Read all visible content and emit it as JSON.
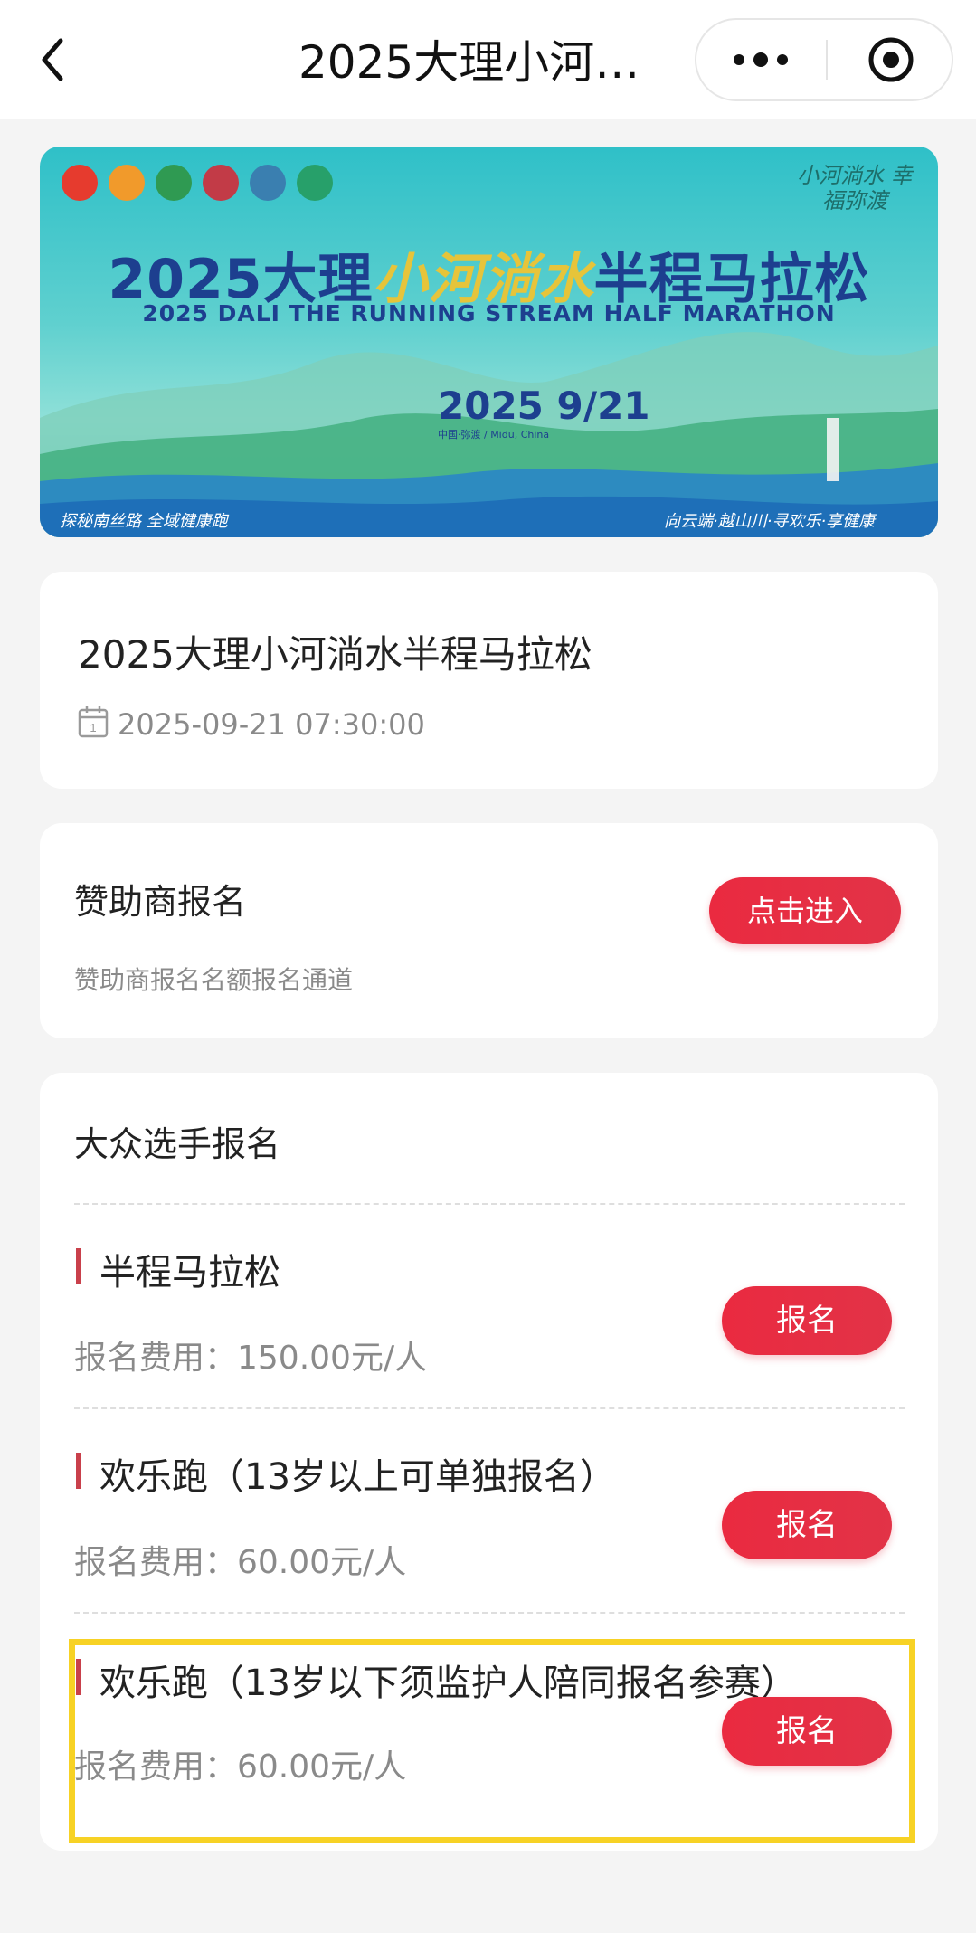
{
  "nav": {
    "title": "2025大理小河…",
    "back_icon": "chevron-left-icon",
    "more_icon": "more-dots-icon",
    "close_icon": "target-close-icon"
  },
  "banner": {
    "title_prefix": "2025大理",
    "title_highlight": "小河淌水",
    "title_suffix": "半程马拉松",
    "title_en": "2025 DALI THE RUNNING STREAM HALF MARATHON",
    "date": "2025 9/21",
    "location": "中国·弥渡 / Midu, China",
    "slogan_right": "小河淌水 幸福弥渡",
    "footer_left": "探秘南丝路 全域健康跑",
    "footer_right": "向云端·越山川·寻欢乐·享健康",
    "colors": {
      "sky": "#2fc0c8",
      "title": "#1d3f8f",
      "highlight": "#e6c43a"
    }
  },
  "event": {
    "title": "2025大理小河淌水半程马拉松",
    "datetime": "2025-09-21 07:30:00",
    "calendar_icon": "calendar-icon"
  },
  "sponsor": {
    "title": "赞助商报名",
    "description": "赞助商报名名额报名通道",
    "button": "点击进入"
  },
  "public": {
    "title": "大众选手报名",
    "races": [
      {
        "name": "半程马拉松",
        "fee": "报名费用：150.00元/人",
        "button": "报名"
      },
      {
        "name": "欢乐跑（13岁以上可单独报名）",
        "fee": "报名费用：60.00元/人",
        "button": "报名"
      },
      {
        "name": "欢乐跑（13岁以下须监护人陪同报名参赛）",
        "fee": "报名费用：60.00元/人",
        "button": "报名"
      }
    ]
  },
  "colors": {
    "accent": "#e62a40",
    "highlight_box": "#f7d225",
    "muted_text": "#8a8a8a"
  }
}
